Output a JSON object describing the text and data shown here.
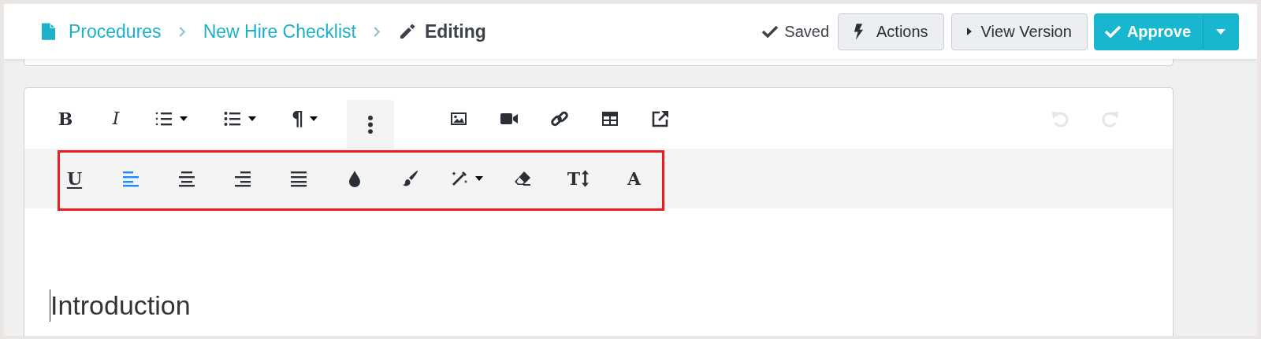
{
  "header": {
    "breadcrumb": [
      {
        "label": "Procedures",
        "kind": "link"
      },
      {
        "label": "New Hire Checklist",
        "kind": "link"
      },
      {
        "label": "Editing",
        "kind": "current"
      }
    ],
    "status": "Saved",
    "buttons": [
      {
        "label": "Actions",
        "kind": "actions"
      },
      {
        "label": "View Version",
        "kind": "view"
      },
      {
        "label": "Approve",
        "kind": "primary"
      }
    ]
  },
  "toolbar": {
    "format": [
      {
        "kind": "bold",
        "label": "B",
        "dropdown": false,
        "pressed": false
      },
      {
        "kind": "italic",
        "label": "I",
        "dropdown": false,
        "pressed": false
      },
      {
        "kind": "ordered-list",
        "dropdown": true,
        "pressed": false
      },
      {
        "kind": "bullet-list",
        "dropdown": true,
        "pressed": false
      },
      {
        "kind": "paragraph",
        "label": "¶",
        "dropdown": true,
        "pressed": false
      },
      {
        "kind": "more",
        "dropdown": false,
        "pressed": true
      }
    ],
    "insert": [
      {
        "kind": "image"
      },
      {
        "kind": "video"
      },
      {
        "kind": "link"
      },
      {
        "kind": "table"
      },
      {
        "kind": "external"
      }
    ],
    "history": [
      {
        "kind": "undo",
        "disabled": true
      },
      {
        "kind": "redo",
        "disabled": true
      }
    ],
    "more_row": {
      "highlighted": true,
      "items": [
        {
          "kind": "underline",
          "label": "U",
          "dropdown": false,
          "selected": false
        },
        {
          "kind": "align-left",
          "dropdown": false,
          "selected": true
        },
        {
          "kind": "align-center",
          "dropdown": false,
          "selected": false
        },
        {
          "kind": "align-right",
          "dropdown": false,
          "selected": false
        },
        {
          "kind": "justify",
          "dropdown": false,
          "selected": false
        },
        {
          "kind": "color",
          "dropdown": false,
          "selected": false
        },
        {
          "kind": "brush",
          "dropdown": false,
          "selected": false
        },
        {
          "kind": "effects",
          "dropdown": true,
          "selected": false
        },
        {
          "kind": "eraser",
          "dropdown": false,
          "selected": false
        },
        {
          "kind": "text-size",
          "label": "T",
          "dropdown": false,
          "selected": false
        },
        {
          "kind": "font",
          "label": "A",
          "dropdown": false,
          "selected": false
        }
      ]
    }
  },
  "editor": {
    "heading": "Introduction",
    "cursor": true
  }
}
